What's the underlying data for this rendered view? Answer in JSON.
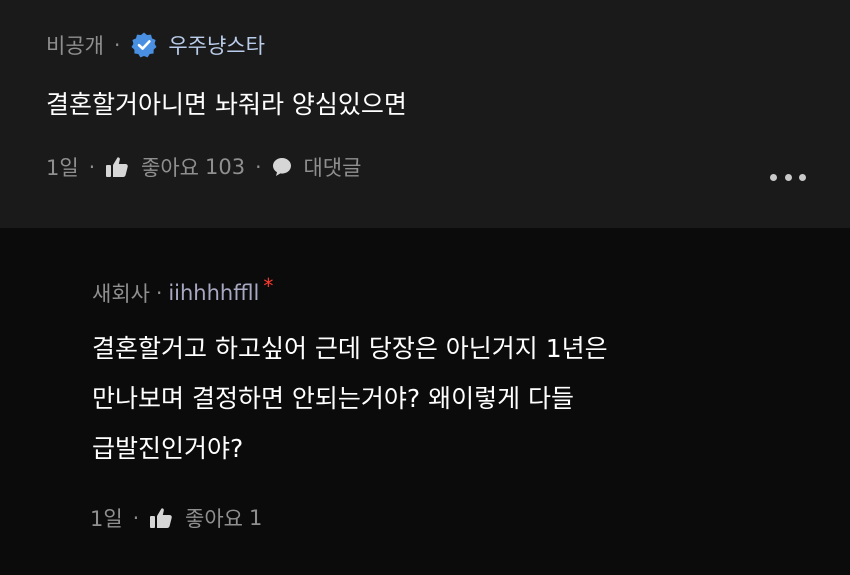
{
  "comments": [
    {
      "visibility": "비공개",
      "nickname": "우주냥스타",
      "verified": true,
      "text": "결혼할거아니면 놔줘라 양심있으면",
      "time": "1일",
      "like_label": "좋아요",
      "like_count": "103",
      "reply_label": "대댓글",
      "more_icon": "more-dots-icon"
    },
    {
      "visibility": "새회사",
      "nickname": "iihhhhffll",
      "marker": "*",
      "text_lines": [
        "결혼할거고 하고싶어 근데 당장은 아닌거지 1년은",
        "만나보며 결정하면 안되는거야? 왜이렇게 다들",
        "급발진인거야?"
      ],
      "time": "1일",
      "like_label": "좋아요",
      "like_count": "1"
    }
  ],
  "colors": {
    "background": "#0b0b0b",
    "top_card": "#1a1a1a",
    "meta_text": "#8f8f8f",
    "verified_badge": "#4a90e2",
    "nickname": "#b9cdea",
    "asterisk": "#ff3b30"
  }
}
